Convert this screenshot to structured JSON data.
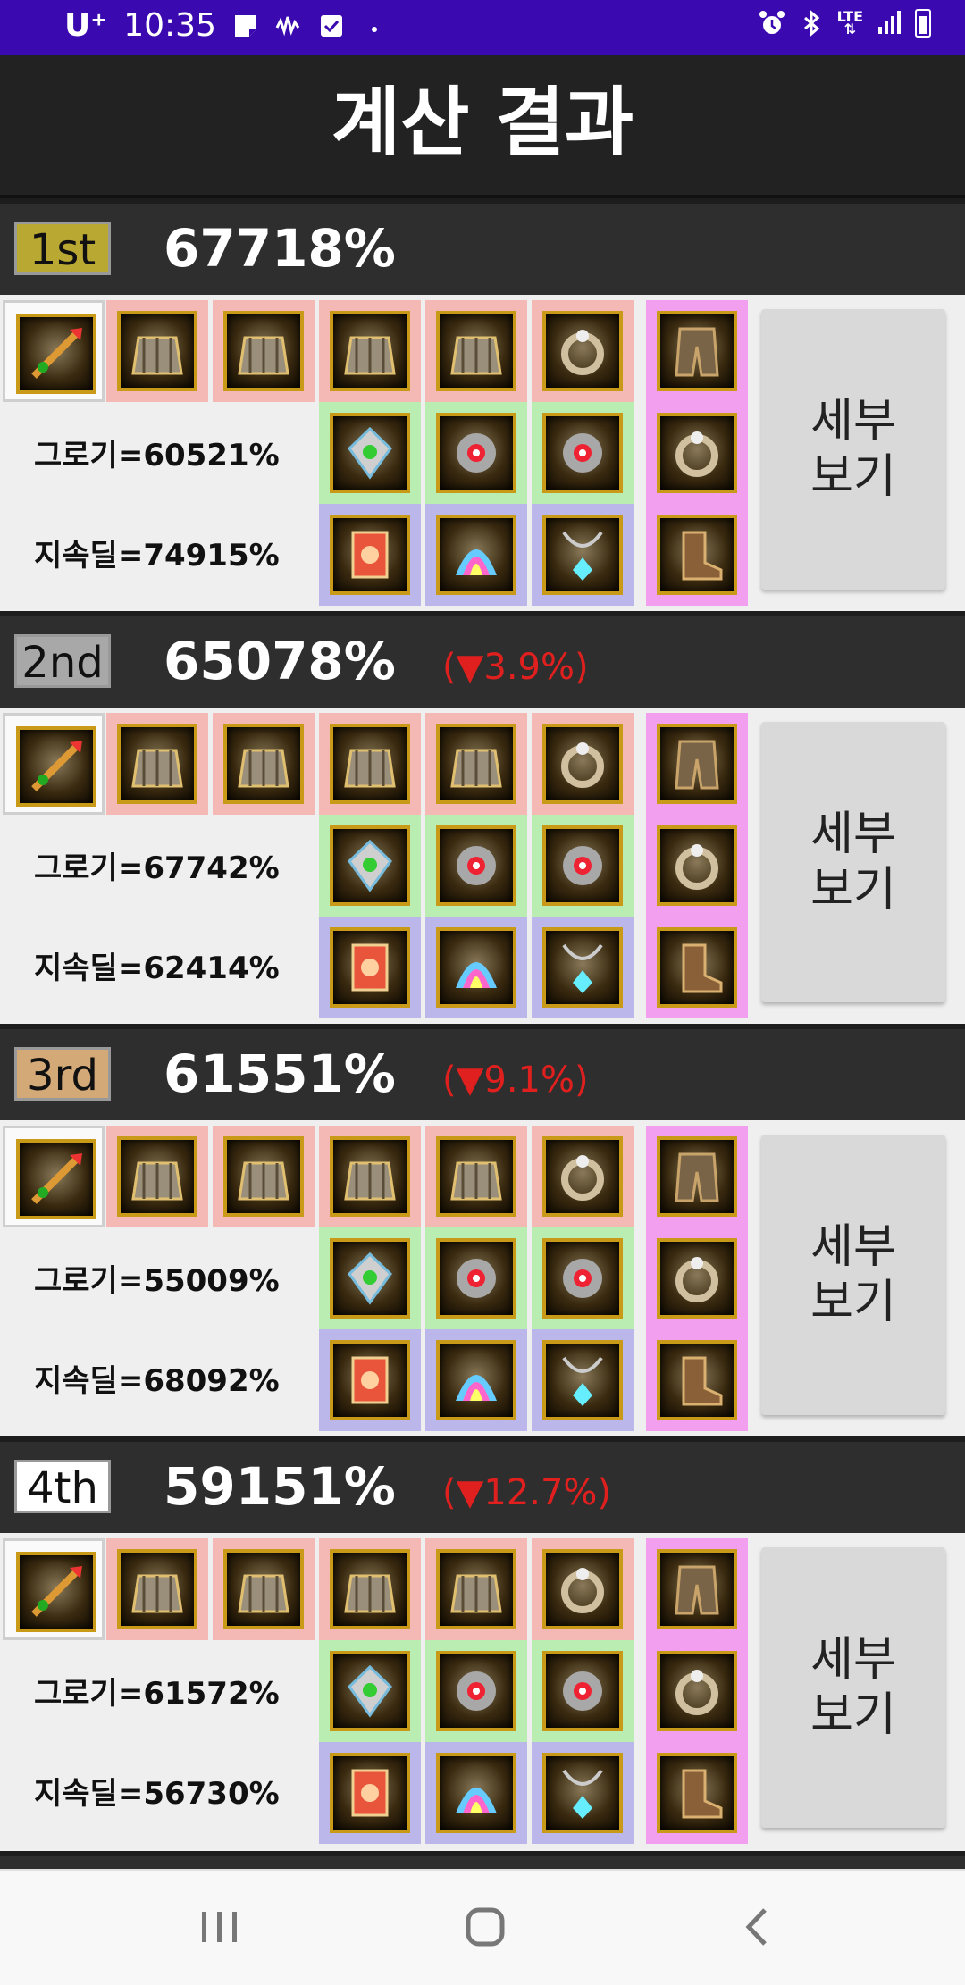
{
  "status_bar": {
    "carrier": "U⁺",
    "time": "10:35",
    "network": "LTE"
  },
  "title": "계산 결과",
  "results": [
    {
      "rank": "1st",
      "rank_color": "#b9a832",
      "percent": "67718%",
      "diff": "",
      "groggy": "그로기=60521%",
      "sustain": "지속딜=74915%",
      "detail_label": "세부\n보기"
    },
    {
      "rank": "2nd",
      "rank_color": "#a8a8a8",
      "percent": "65078%",
      "diff": "(▼3.9%)",
      "groggy": "그로기=67742%",
      "sustain": "지속딜=62414%",
      "detail_label": "세부\n보기"
    },
    {
      "rank": "3rd",
      "rank_color": "#d4a978",
      "percent": "61551%",
      "diff": "(▼9.1%)",
      "groggy": "그로기=55009%",
      "sustain": "지속딜=68092%",
      "detail_label": "세부\n보기"
    },
    {
      "rank": "4th",
      "rank_color": "#ffffff",
      "percent": "59151%",
      "diff": "(▼12.7%)",
      "groggy": "그로기=61572%",
      "sustain": "지속딜=56730%",
      "detail_label": "세부\n보기"
    }
  ],
  "colors": {
    "status_bar": "#3a0ab0",
    "title_bar": "#222222",
    "rank_header": "#2e2e2e",
    "diff_red": "#e0201e",
    "slot_red": "#f4b9b5",
    "slot_green": "#b9edb2",
    "slot_blue": "#bbb7ea",
    "slot_pink": "#f29ff0"
  }
}
